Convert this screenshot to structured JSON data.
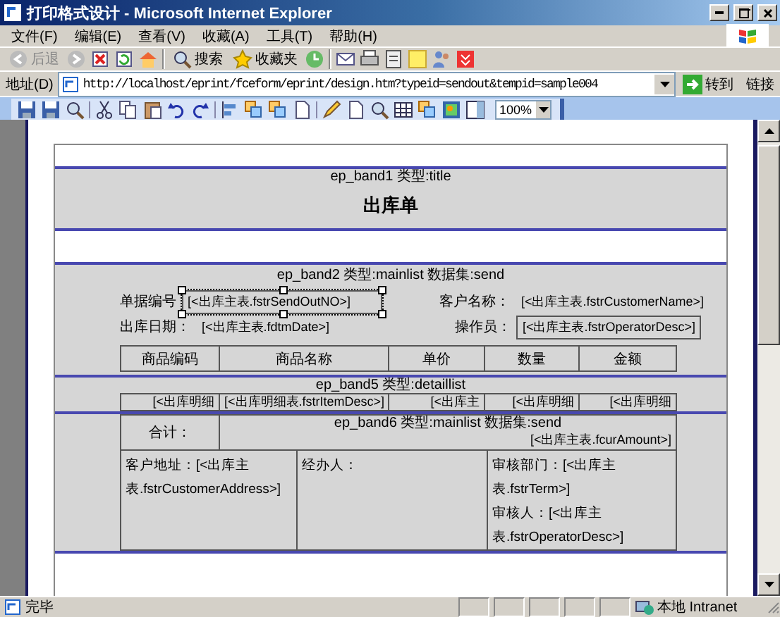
{
  "window": {
    "title": "打印格式设计 - Microsoft Internet Explorer"
  },
  "menu": [
    {
      "label": "文件(F)"
    },
    {
      "label": "编辑(E)"
    },
    {
      "label": "查看(V)"
    },
    {
      "label": "收藏(A)"
    },
    {
      "label": "工具(T)"
    },
    {
      "label": "帮助(H)"
    }
  ],
  "toolbar": {
    "back": "后退",
    "search": "搜索",
    "favorites": "收藏夹"
  },
  "address": {
    "label": "地址(D)",
    "url": "http://localhost/eprint/fceform/eprint/design.htm?typeid=sendout&tempid=sample004",
    "go": "转到",
    "links": "链接"
  },
  "design_toolbar": {
    "zoom": "100%"
  },
  "report": {
    "band1": {
      "label": "ep_band1 类型:title",
      "title": "出库单"
    },
    "band2": {
      "label": "ep_band2 类型:mainlist 数据集:send",
      "fields": [
        {
          "label": "单据编号",
          "value": "[<出库主表.fstrSendOutNO>]",
          "kind": "box",
          "selected": true
        },
        {
          "label": "客户名称：",
          "value": "[<出库主表.fstrCustomerName>]",
          "kind": "plain",
          "selected": false
        },
        {
          "label": "出库日期：",
          "value": "[<出库主表.fdtmDate>]",
          "kind": "plain",
          "selected": false
        },
        {
          "label": "操作员：",
          "value": "[<出库主表.fstrOperatorDesc>]",
          "kind": "box",
          "selected": false
        }
      ],
      "columns": [
        "商品编码",
        "商品名称",
        "单价",
        "数量",
        "金额"
      ]
    },
    "band5": {
      "label": "ep_band5 类型:detaillist",
      "cells": [
        "[<出库明细",
        "[<出库明细表.fstrItemDesc>]",
        "[<出库主",
        "[<出库明细",
        "[<出库明细"
      ]
    },
    "band6": {
      "label": "ep_band6 类型:mainlist 数据集:send",
      "total_label": "合计：",
      "total_value": "[<出库主表.fcurAmount>]",
      "footer": [
        [
          "客户地址：[<出库主表.fstrCustomerAddress>]"
        ],
        [
          "经办人："
        ],
        [
          "审核部门：[<出库主表.fstrTerm>]",
          "审核人：[<出库主表.fstrOperatorDesc>]"
        ]
      ]
    }
  },
  "status_bar": {
    "text": "完毕",
    "zone": "本地 Intranet"
  }
}
